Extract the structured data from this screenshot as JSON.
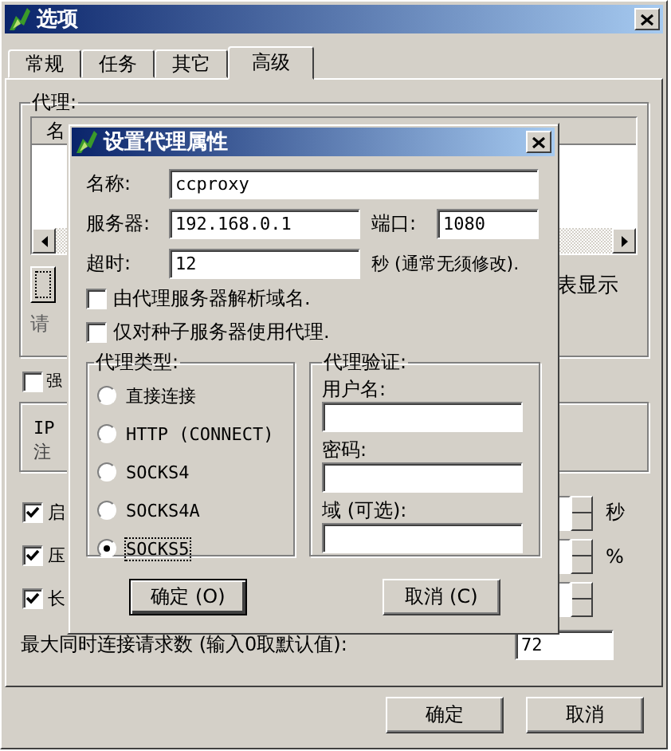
{
  "window": {
    "title": "选项"
  },
  "tabs": [
    {
      "label": "常规",
      "selected": false
    },
    {
      "label": "任务",
      "selected": false
    },
    {
      "label": "其它",
      "selected": false
    },
    {
      "label": "高级",
      "selected": true
    }
  ],
  "proxy_group": {
    "label": "代理:",
    "list_header": "名",
    "side_text": "表显示",
    "hint": "请"
  },
  "force_checkbox": {
    "label": "强",
    "checked": false
  },
  "info_group": {
    "lines": [
      "IP",
      "注"
    ]
  },
  "options": [
    {
      "label": "启",
      "checked": true,
      "unit": "秒"
    },
    {
      "label": "压",
      "checked": true,
      "unit": "%"
    },
    {
      "label": "长",
      "checked": true
    }
  ],
  "max_connections": {
    "label": "最大同时连接请求数 (输入0取默认值):",
    "value": "72"
  },
  "buttons": [
    "确定",
    "取消"
  ],
  "proxy_dialog": {
    "title": "设置代理属性",
    "name": {
      "label": "名称:",
      "value": "ccproxy"
    },
    "server": {
      "label": "服务器:",
      "value": "192.168.0.1"
    },
    "port": {
      "label": "端口:",
      "value": "1080"
    },
    "timeout": {
      "label": "超时:",
      "value": "12",
      "note": "秒 (通常无须修改)."
    },
    "checkboxes": [
      {
        "label": "由代理服务器解析域名.",
        "checked": false
      },
      {
        "label": "仅对种子服务器使用代理.",
        "checked": false
      }
    ],
    "type_group": {
      "label": "代理类型:",
      "options": [
        {
          "label": "直接连接",
          "selected": false
        },
        {
          "label": "HTTP (CONNECT)",
          "selected": false
        },
        {
          "label": "SOCKS4",
          "selected": false
        },
        {
          "label": "SOCKS4A",
          "selected": false
        },
        {
          "label": "SOCKS5",
          "selected": true
        }
      ]
    },
    "auth_group": {
      "label": "代理验证:",
      "fields": [
        {
          "label": "用户名:"
        },
        {
          "label": "密码:"
        },
        {
          "label": "域 (可选):"
        }
      ]
    },
    "buttons": [
      "确定 (O)",
      "取消 (C)"
    ]
  }
}
